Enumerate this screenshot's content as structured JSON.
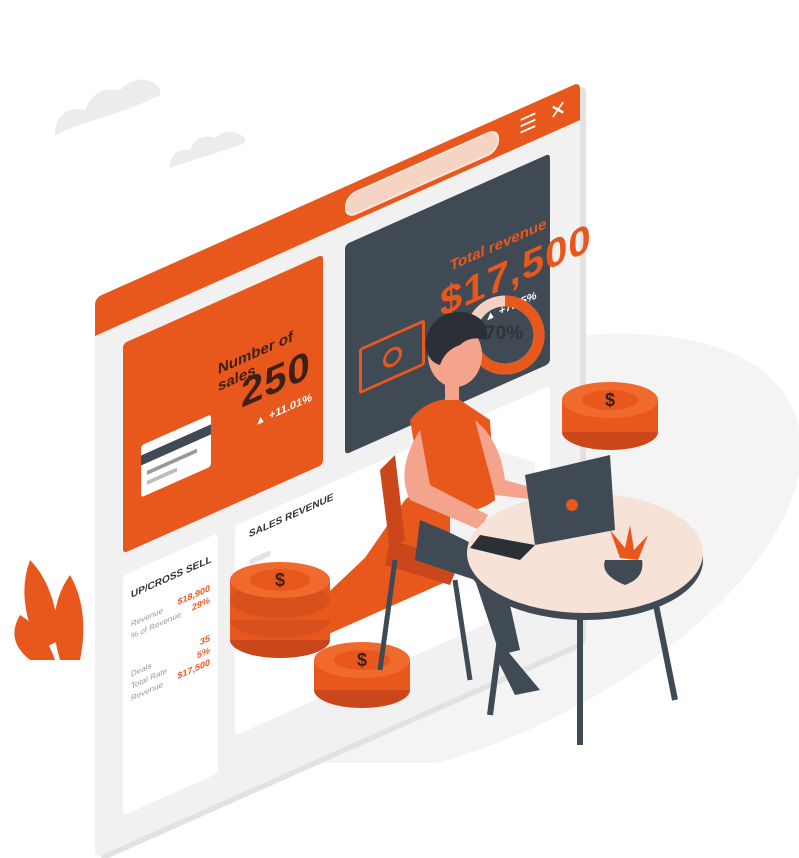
{
  "window": {
    "menu_icon": "menu-icon",
    "close_icon": "close-icon",
    "menu_glyph": "☰",
    "close_glyph": "✕"
  },
  "sales_card": {
    "title": "Number of sales",
    "value": "250",
    "delta": "▲ +11.01%",
    "icon": "credit-card-icon"
  },
  "revenue_card": {
    "title": "Total revenue",
    "value": "$17,500",
    "delta": "▲ +7.05%",
    "icon": "banknote-icon"
  },
  "donut": {
    "label": "70%",
    "percent": 70
  },
  "sales_revenue": {
    "title": "SALES REVENUE"
  },
  "upsell": {
    "title": "UP/CROSS SELL",
    "rows": [
      {
        "label": "Revenue",
        "value": "$18,900"
      },
      {
        "label": "% of Revenue",
        "value": "29%"
      },
      {
        "label": "Deals",
        "value": "35"
      },
      {
        "label": "Total Rate",
        "value": "5%"
      },
      {
        "label": "Revenue",
        "value": "$17,500"
      }
    ]
  },
  "colors": {
    "accent": "#e8581c",
    "dark": "#404a55",
    "skin": "#f4a38c",
    "table": "#f7e2d8"
  }
}
